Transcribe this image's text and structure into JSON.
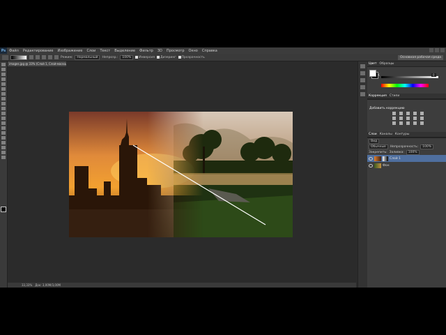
{
  "menu": {
    "logo": "Ps",
    "items": [
      "Файл",
      "Редактирование",
      "Изображение",
      "Слои",
      "Текст",
      "Выделение",
      "Фильтр",
      "3D",
      "Просмотр",
      "Окно",
      "Справка"
    ]
  },
  "options": {
    "mode_label": "Режим:",
    "mode_value": "Нормальный",
    "opacity_label": "Непрозр.:",
    "opacity_value": "100%",
    "checks": [
      "Инверсия",
      "Дизеринг",
      "Прозрачность"
    ],
    "workspace": "Основная рабочая среда"
  },
  "document": {
    "tab": "images.jpg @ 33% (Слой 1, Слой-маска/8) *",
    "zoom": "33,33%",
    "doc_info": "Док: 3,00М/3,00М"
  },
  "color_panel": {
    "tabs": [
      "Цвет",
      "Образцы"
    ],
    "slider_label": "K",
    "slider_value": "0"
  },
  "adjustments_panel": {
    "tabs": [
      "Коррекция",
      "Стили"
    ],
    "title": "Добавить коррекцию"
  },
  "layers_panel": {
    "tabs": [
      "Слои",
      "Каналы",
      "Контуры"
    ],
    "kind_label": "Вид",
    "blend": "Обычные",
    "opacity_label": "Непрозрачность:",
    "opacity_value": "100%",
    "lock_label": "Закрепить:",
    "fill_label": "Заливка:",
    "fill_value": "100%",
    "layers": [
      {
        "name": "Слой 1",
        "selected": true
      },
      {
        "name": "Фон",
        "selected": false
      }
    ]
  }
}
